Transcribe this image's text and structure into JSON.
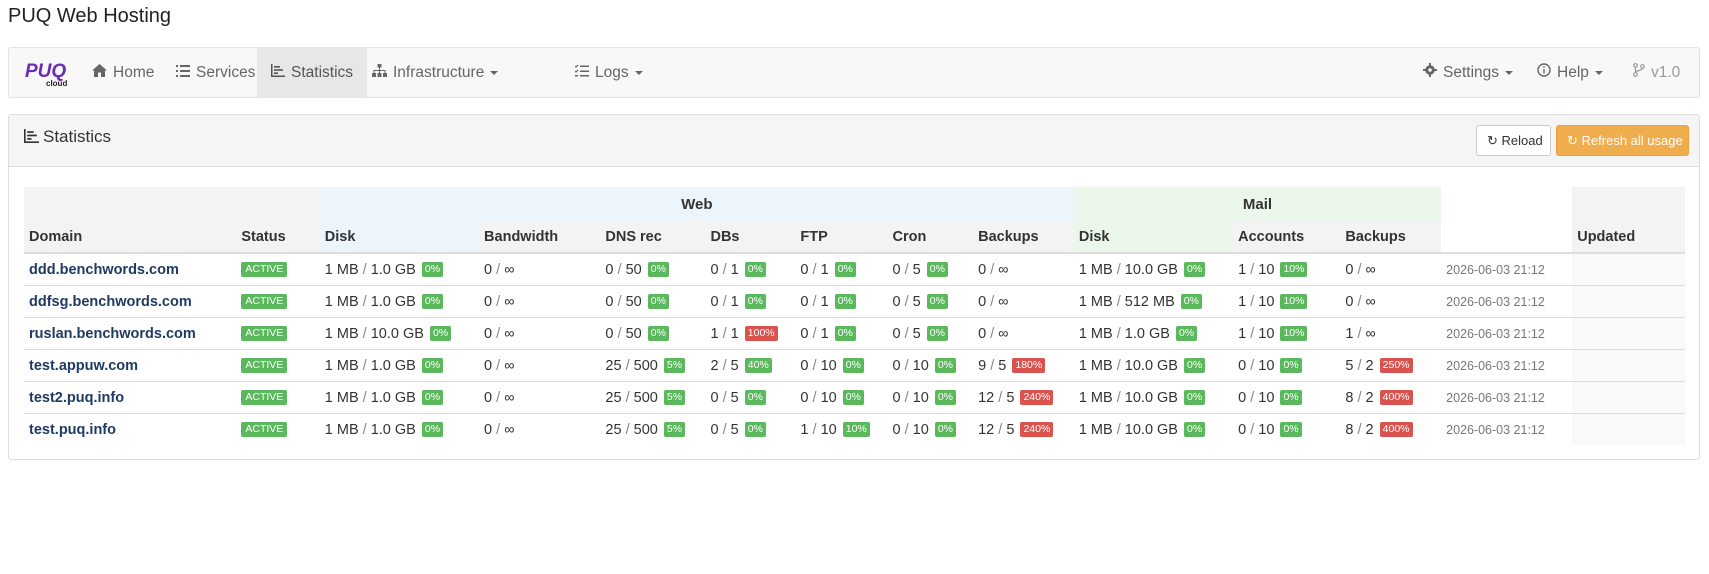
{
  "page_title": "PUQ Web Hosting",
  "brand": {
    "logo_text": "PUQ",
    "logo_sub": "cloud"
  },
  "nav": {
    "home": "Home",
    "services": "Services",
    "statistics": "Statistics",
    "infrastructure": "Infrastructure",
    "logs": "Logs",
    "settings": "Settings",
    "help": "Help",
    "version": "v1.0"
  },
  "panel": {
    "title": "Statistics",
    "reload_label": "Reload",
    "refresh_label": "Refresh all usage"
  },
  "table": {
    "groups": {
      "web": "Web",
      "mail": "Mail"
    },
    "headers": {
      "domain": "Domain",
      "status": "Status",
      "disk": "Disk",
      "bandwidth": "Bandwidth",
      "dns": "DNS rec",
      "dbs": "DBs",
      "ftp": "FTP",
      "cron": "Cron",
      "backups": "Backups",
      "mail_disk": "Disk",
      "accounts": "Accounts",
      "mail_backups": "Backups",
      "updated": "Updated"
    },
    "rows": [
      {
        "domain": "ddd.benchwords.com",
        "status": "ACTIVE",
        "disk": {
          "u": "1 MB",
          "t": "1.0 GB",
          "p": "0%"
        },
        "bw": {
          "u": "0",
          "t": "∞"
        },
        "dns": {
          "u": "0",
          "t": "50",
          "p": "0%"
        },
        "dbs": {
          "u": "0",
          "t": "1",
          "p": "0%"
        },
        "ftp": {
          "u": "0",
          "t": "1",
          "p": "0%"
        },
        "cron": {
          "u": "0",
          "t": "5",
          "p": "0%"
        },
        "backups": {
          "u": "0",
          "t": "∞"
        },
        "mdisk": {
          "u": "1 MB",
          "t": "10.0 GB",
          "p": "0%"
        },
        "acc": {
          "u": "1",
          "t": "10",
          "p": "10%"
        },
        "mbk": {
          "u": "0",
          "t": "∞"
        },
        "updated": "2026-06-03 21:12"
      },
      {
        "domain": "ddfsg.benchwords.com",
        "status": "ACTIVE",
        "disk": {
          "u": "1 MB",
          "t": "1.0 GB",
          "p": "0%"
        },
        "bw": {
          "u": "0",
          "t": "∞"
        },
        "dns": {
          "u": "0",
          "t": "50",
          "p": "0%"
        },
        "dbs": {
          "u": "0",
          "t": "1",
          "p": "0%"
        },
        "ftp": {
          "u": "0",
          "t": "1",
          "p": "0%"
        },
        "cron": {
          "u": "0",
          "t": "5",
          "p": "0%"
        },
        "backups": {
          "u": "0",
          "t": "∞"
        },
        "mdisk": {
          "u": "1 MB",
          "t": "512 MB",
          "p": "0%"
        },
        "acc": {
          "u": "1",
          "t": "10",
          "p": "10%"
        },
        "mbk": {
          "u": "0",
          "t": "∞"
        },
        "updated": "2026-06-03 21:12"
      },
      {
        "domain": "ruslan.benchwords.com",
        "status": "ACTIVE",
        "disk": {
          "u": "1 MB",
          "t": "10.0 GB",
          "p": "0%"
        },
        "bw": {
          "u": "0",
          "t": "∞"
        },
        "dns": {
          "u": "0",
          "t": "50",
          "p": "0%"
        },
        "dbs": {
          "u": "1",
          "t": "1",
          "p": "100%"
        },
        "ftp": {
          "u": "0",
          "t": "1",
          "p": "0%"
        },
        "cron": {
          "u": "0",
          "t": "5",
          "p": "0%"
        },
        "backups": {
          "u": "0",
          "t": "∞"
        },
        "mdisk": {
          "u": "1 MB",
          "t": "1.0 GB",
          "p": "0%"
        },
        "acc": {
          "u": "1",
          "t": "10",
          "p": "10%"
        },
        "mbk": {
          "u": "1",
          "t": "∞"
        },
        "updated": "2026-06-03 21:12"
      },
      {
        "domain": "test.appuw.com",
        "status": "ACTIVE",
        "disk": {
          "u": "1 MB",
          "t": "1.0 GB",
          "p": "0%"
        },
        "bw": {
          "u": "0",
          "t": "∞"
        },
        "dns": {
          "u": "25",
          "t": "500",
          "p": "5%"
        },
        "dbs": {
          "u": "2",
          "t": "5",
          "p": "40%"
        },
        "ftp": {
          "u": "0",
          "t": "10",
          "p": "0%"
        },
        "cron": {
          "u": "0",
          "t": "10",
          "p": "0%"
        },
        "backups": {
          "u": "9",
          "t": "5",
          "p": "180%"
        },
        "mdisk": {
          "u": "1 MB",
          "t": "10.0 GB",
          "p": "0%"
        },
        "acc": {
          "u": "0",
          "t": "10",
          "p": "0%"
        },
        "mbk": {
          "u": "5",
          "t": "2",
          "p": "250%"
        },
        "updated": "2026-06-03 21:12"
      },
      {
        "domain": "test2.puq.info",
        "status": "ACTIVE",
        "disk": {
          "u": "1 MB",
          "t": "1.0 GB",
          "p": "0%"
        },
        "bw": {
          "u": "0",
          "t": "∞"
        },
        "dns": {
          "u": "25",
          "t": "500",
          "p": "5%"
        },
        "dbs": {
          "u": "0",
          "t": "5",
          "p": "0%"
        },
        "ftp": {
          "u": "0",
          "t": "10",
          "p": "0%"
        },
        "cron": {
          "u": "0",
          "t": "10",
          "p": "0%"
        },
        "backups": {
          "u": "12",
          "t": "5",
          "p": "240%"
        },
        "mdisk": {
          "u": "1 MB",
          "t": "10.0 GB",
          "p": "0%"
        },
        "acc": {
          "u": "0",
          "t": "10",
          "p": "0%"
        },
        "mbk": {
          "u": "8",
          "t": "2",
          "p": "400%"
        },
        "updated": "2026-06-03 21:12"
      },
      {
        "domain": "test.puq.info",
        "status": "ACTIVE",
        "disk": {
          "u": "1 MB",
          "t": "1.0 GB",
          "p": "0%"
        },
        "bw": {
          "u": "0",
          "t": "∞"
        },
        "dns": {
          "u": "25",
          "t": "500",
          "p": "5%"
        },
        "dbs": {
          "u": "0",
          "t": "5",
          "p": "0%"
        },
        "ftp": {
          "u": "1",
          "t": "10",
          "p": "10%"
        },
        "cron": {
          "u": "0",
          "t": "10",
          "p": "0%"
        },
        "backups": {
          "u": "12",
          "t": "5",
          "p": "240%"
        },
        "mdisk": {
          "u": "1 MB",
          "t": "10.0 GB",
          "p": "0%"
        },
        "acc": {
          "u": "0",
          "t": "10",
          "p": "0%"
        },
        "mbk": {
          "u": "8",
          "t": "2",
          "p": "400%"
        },
        "updated": "2026-06-03 21:12"
      }
    ]
  },
  "colors": {
    "ok": "#5cb85c",
    "bad": "#d9534f",
    "accent": "#f0ad4e",
    "domain": "#1f3a63"
  }
}
